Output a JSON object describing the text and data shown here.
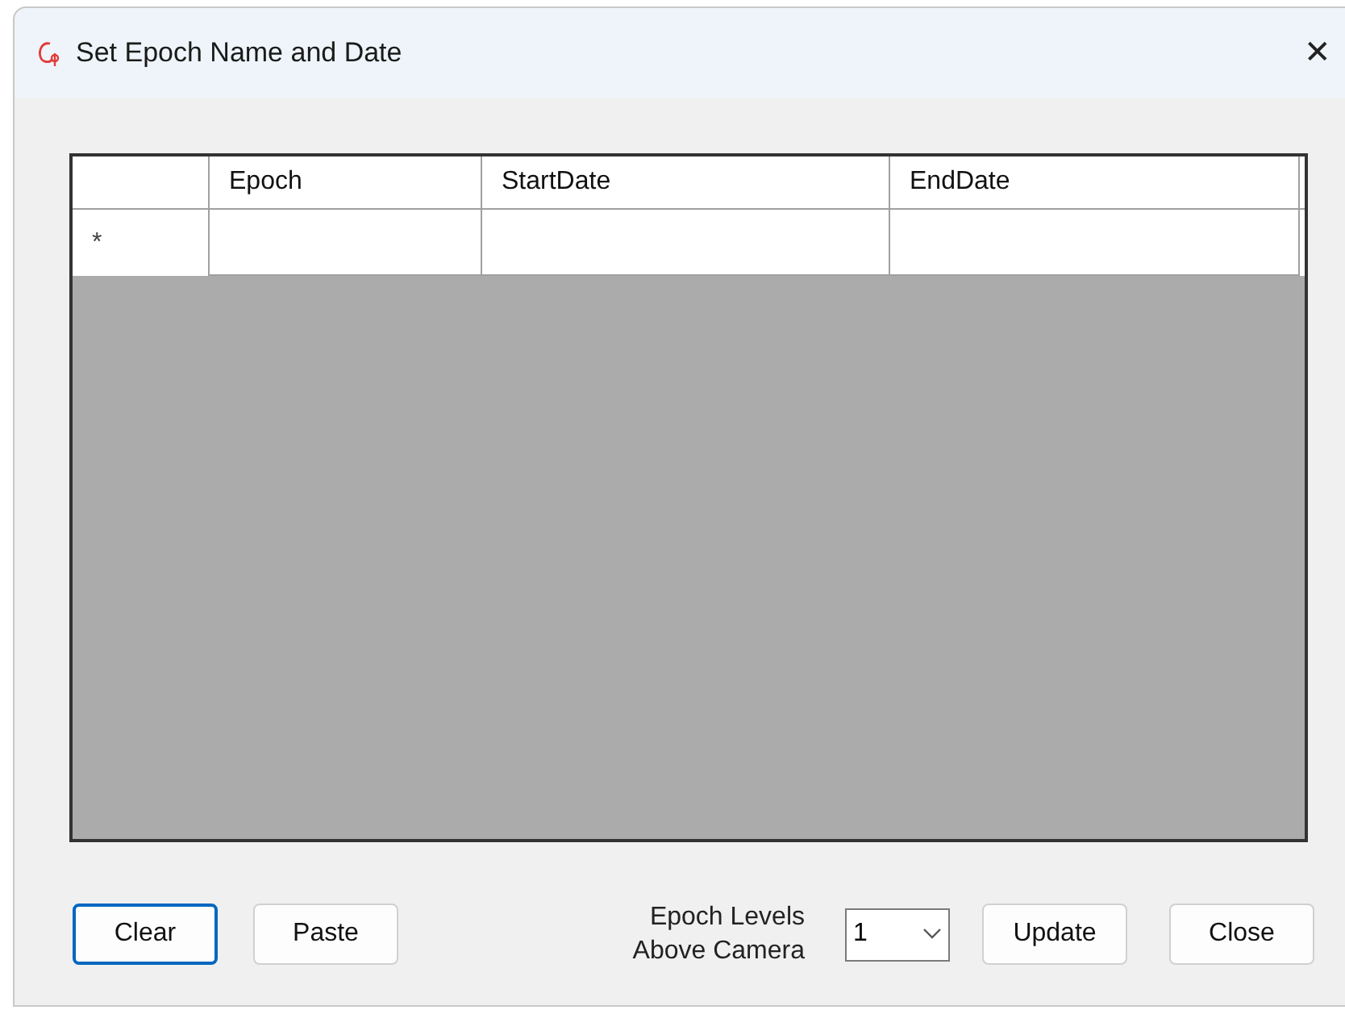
{
  "window": {
    "title": "Set Epoch Name and Date",
    "close": "✕"
  },
  "grid": {
    "columns": [
      "Epoch",
      "StartDate",
      "EndDate"
    ],
    "new_row_marker": "*"
  },
  "buttons": [
    {
      "label": "Clear",
      "focused": true
    },
    {
      "label": "Paste",
      "focused": false
    }
  ],
  "levels": {
    "label_lines": [
      "Epoch Levels",
      "Above Camera"
    ],
    "value": "1"
  },
  "actions": [
    {
      "label": "Update",
      "focused": false
    },
    {
      "label": "Close",
      "focused": false
    }
  ]
}
